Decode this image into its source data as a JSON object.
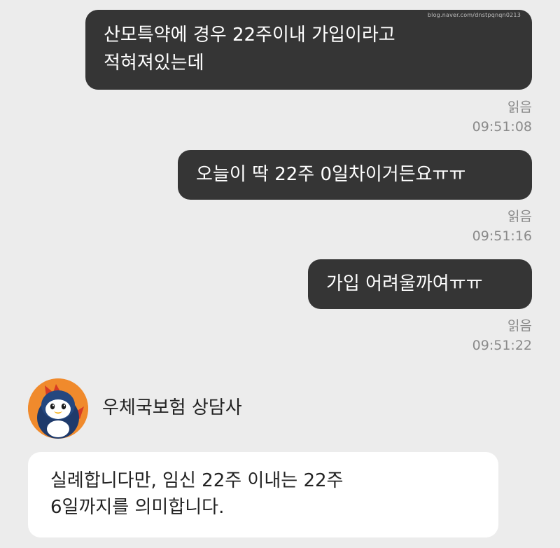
{
  "watermark": "blog.naver.com/dnstpqnqn0213",
  "outgoing": [
    {
      "lines": [
        "산모특약에 경우 22주이내 가입이라고",
        "적혀져있는데"
      ],
      "status": "읽음",
      "time": "09:51:08"
    },
    {
      "lines": [
        "오늘이 딱 22주 0일차이거든요ㅠㅠ"
      ],
      "status": "읽음",
      "time": "09:51:16"
    },
    {
      "lines": [
        "가입 어려울까여ㅠㅠ"
      ],
      "status": "읽음",
      "time": "09:51:22"
    }
  ],
  "incoming": {
    "sender": "우체국보험 상담사",
    "avatar_icon": "penguin-mascot-icon",
    "avatar_color": "#f08a2c",
    "lines": [
      "실례합니다만, 임신 22주 이내는 22주",
      "6일까지를 의미합니다."
    ]
  },
  "colors": {
    "background": "#ececec",
    "outgoing_bubble": "#353535",
    "incoming_bubble": "#ffffff"
  }
}
